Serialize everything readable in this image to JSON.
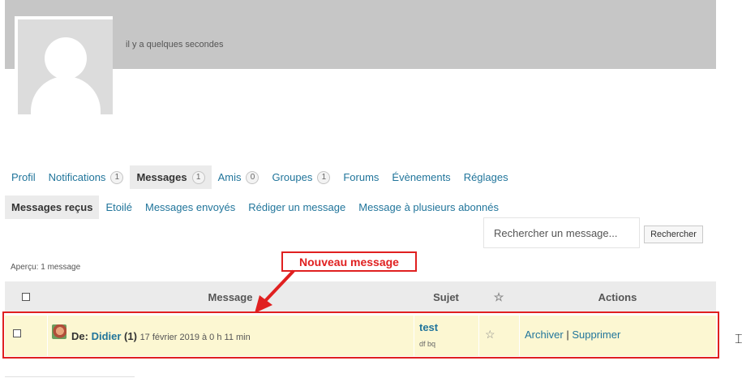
{
  "profile": {
    "last_active": "il y a quelques secondes"
  },
  "nav": {
    "items": [
      {
        "label": "Profil",
        "count": null
      },
      {
        "label": "Notifications",
        "count": "1"
      },
      {
        "label": "Messages",
        "count": "1",
        "active": true
      },
      {
        "label": "Amis",
        "count": "0"
      },
      {
        "label": "Groupes",
        "count": "1"
      },
      {
        "label": "Forums",
        "count": null
      },
      {
        "label": "Évènements",
        "count": null
      },
      {
        "label": "Réglages",
        "count": null
      }
    ]
  },
  "subnav": {
    "items": [
      {
        "label": "Messages reçus",
        "active": true
      },
      {
        "label": "Etoilé"
      },
      {
        "label": "Messages envoyés"
      },
      {
        "label": "Rédiger un message"
      },
      {
        "label": "Message à plusieurs abonnés"
      }
    ]
  },
  "search": {
    "placeholder": "Rechercher un message...",
    "button_label": "Rechercher"
  },
  "preview": "Aperçu: 1 message",
  "table": {
    "headers": {
      "message": "Message",
      "subject": "Sujet",
      "actions": "Actions"
    },
    "rows": [
      {
        "from_prefix": "De:",
        "sender": "Didier",
        "count": "(1)",
        "date": "17 février 2019 à 0 h 11 min",
        "subject": "test",
        "excerpt": "df bq",
        "archive_label": "Archiver",
        "separator": "|",
        "delete_label": "Supprimer"
      }
    ]
  },
  "annotation": {
    "callout_text": "Nouveau message",
    "color": "#e02020"
  },
  "colors": {
    "link": "#21759b",
    "unread_row": "#fcf7d2",
    "header_bg": "#ebebeb",
    "cover": "#c6c6c6"
  }
}
